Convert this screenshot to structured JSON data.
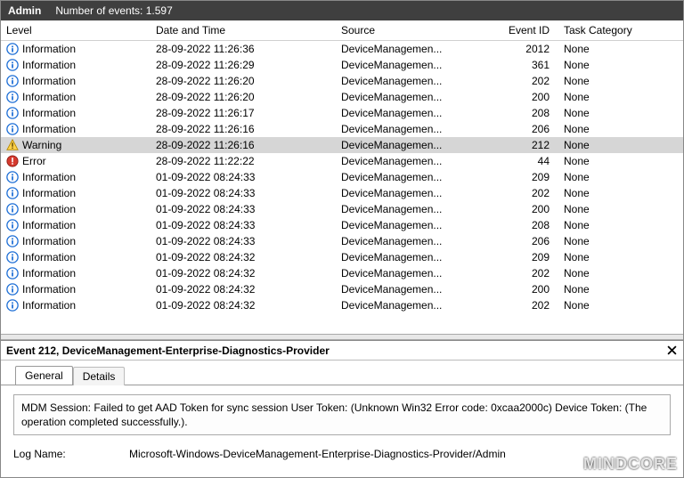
{
  "titlebar": {
    "title": "Admin",
    "subtitle": "Number of events: 1.597"
  },
  "columns": {
    "level": "Level",
    "datetime": "Date and Time",
    "source": "Source",
    "eventid": "Event ID",
    "task": "Task Category"
  },
  "icons": {
    "info": "info-icon",
    "warning": "warning-icon",
    "error": "error-icon"
  },
  "events": [
    {
      "level": "Information",
      "icon": "info",
      "dt": "28-09-2022 11:26:36",
      "src": "DeviceManagemen...",
      "eid": "2012",
      "task": "None",
      "sel": false
    },
    {
      "level": "Information",
      "icon": "info",
      "dt": "28-09-2022 11:26:29",
      "src": "DeviceManagemen...",
      "eid": "361",
      "task": "None",
      "sel": false
    },
    {
      "level": "Information",
      "icon": "info",
      "dt": "28-09-2022 11:26:20",
      "src": "DeviceManagemen...",
      "eid": "202",
      "task": "None",
      "sel": false
    },
    {
      "level": "Information",
      "icon": "info",
      "dt": "28-09-2022 11:26:20",
      "src": "DeviceManagemen...",
      "eid": "200",
      "task": "None",
      "sel": false
    },
    {
      "level": "Information",
      "icon": "info",
      "dt": "28-09-2022 11:26:17",
      "src": "DeviceManagemen...",
      "eid": "208",
      "task": "None",
      "sel": false
    },
    {
      "level": "Information",
      "icon": "info",
      "dt": "28-09-2022 11:26:16",
      "src": "DeviceManagemen...",
      "eid": "206",
      "task": "None",
      "sel": false
    },
    {
      "level": "Warning",
      "icon": "warning",
      "dt": "28-09-2022 11:26:16",
      "src": "DeviceManagemen...",
      "eid": "212",
      "task": "None",
      "sel": true
    },
    {
      "level": "Error",
      "icon": "error",
      "dt": "28-09-2022 11:22:22",
      "src": "DeviceManagemen...",
      "eid": "44",
      "task": "None",
      "sel": false
    },
    {
      "level": "Information",
      "icon": "info",
      "dt": "01-09-2022 08:24:33",
      "src": "DeviceManagemen...",
      "eid": "209",
      "task": "None",
      "sel": false
    },
    {
      "level": "Information",
      "icon": "info",
      "dt": "01-09-2022 08:24:33",
      "src": "DeviceManagemen...",
      "eid": "202",
      "task": "None",
      "sel": false
    },
    {
      "level": "Information",
      "icon": "info",
      "dt": "01-09-2022 08:24:33",
      "src": "DeviceManagemen...",
      "eid": "200",
      "task": "None",
      "sel": false
    },
    {
      "level": "Information",
      "icon": "info",
      "dt": "01-09-2022 08:24:33",
      "src": "DeviceManagemen...",
      "eid": "208",
      "task": "None",
      "sel": false
    },
    {
      "level": "Information",
      "icon": "info",
      "dt": "01-09-2022 08:24:33",
      "src": "DeviceManagemen...",
      "eid": "206",
      "task": "None",
      "sel": false
    },
    {
      "level": "Information",
      "icon": "info",
      "dt": "01-09-2022 08:24:32",
      "src": "DeviceManagemen...",
      "eid": "209",
      "task": "None",
      "sel": false
    },
    {
      "level": "Information",
      "icon": "info",
      "dt": "01-09-2022 08:24:32",
      "src": "DeviceManagemen...",
      "eid": "202",
      "task": "None",
      "sel": false
    },
    {
      "level": "Information",
      "icon": "info",
      "dt": "01-09-2022 08:24:32",
      "src": "DeviceManagemen...",
      "eid": "200",
      "task": "None",
      "sel": false
    },
    {
      "level": "Information",
      "icon": "info",
      "dt": "01-09-2022 08:24:32",
      "src": "DeviceManagemen...",
      "eid": "202",
      "task": "None",
      "sel": false
    }
  ],
  "detail": {
    "header": "Event 212, DeviceManagement-Enterprise-Diagnostics-Provider",
    "tabs": {
      "general": "General",
      "details": "Details"
    },
    "message": "MDM Session: Failed to get AAD Token for sync session User Token: (Unknown Win32 Error code: 0xcaa2000c) Device Token: (The operation completed successfully.).",
    "log_name_label": "Log Name:",
    "log_name_value": "Microsoft-Windows-DeviceManagement-Enterprise-Diagnostics-Provider/Admin"
  },
  "watermark": "MINDCORE"
}
